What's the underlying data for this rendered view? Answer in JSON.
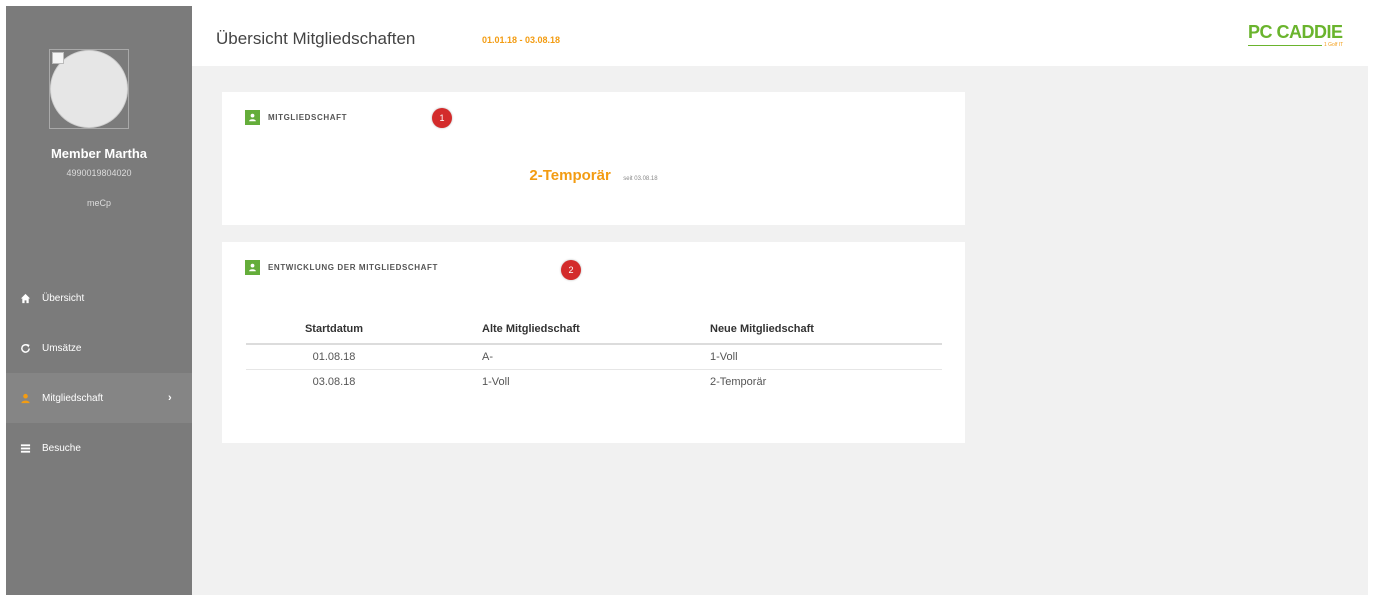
{
  "header": {
    "title": "Übersicht Mitgliedschaften",
    "date_range": "01.01.18 - 03.08.18",
    "logo_text": "PC CADDIE",
    "logo_sub": "1 Golf IT"
  },
  "user": {
    "name": "Member Martha",
    "id": "4990019804020",
    "app": "meCp"
  },
  "nav": {
    "items": [
      {
        "label": "Übersicht",
        "icon": "home-icon"
      },
      {
        "label": "Umsätze",
        "icon": "refresh-icon"
      },
      {
        "label": "Mitgliedschaft",
        "icon": "user-icon",
        "active": true
      },
      {
        "label": "Besuche",
        "icon": "list-icon"
      }
    ]
  },
  "card1": {
    "title": "MITGLIEDSCHAFT",
    "badge": "1",
    "value": "2-Temporär",
    "since": "seit 03.08.18"
  },
  "card2": {
    "title": "ENTWICKLUNG DER MITGLIEDSCHAFT",
    "badge": "2",
    "columns": [
      "Startdatum",
      "Alte Mitgliedschaft",
      "Neue Mitgliedschaft"
    ],
    "rows": [
      [
        "01.08.18",
        "A-",
        "1-Voll"
      ],
      [
        "03.08.18",
        "1-Voll",
        "2-Temporär"
      ]
    ]
  },
  "colors": {
    "accent": "#f39c12",
    "brand_green": "#64ad3a",
    "badge_red": "#d32b2b",
    "sidebar": "#7b7b7b"
  }
}
